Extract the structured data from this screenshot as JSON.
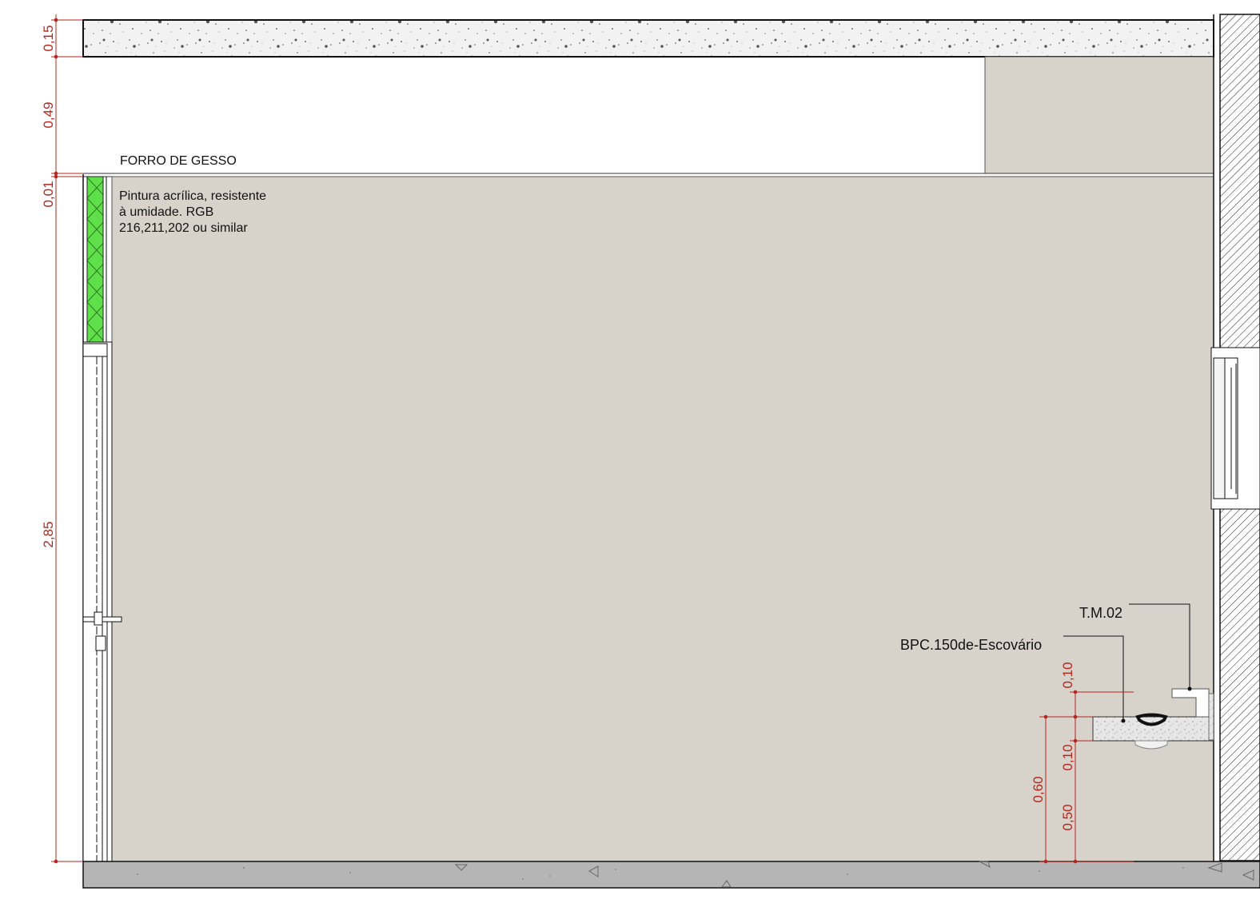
{
  "colors": {
    "wall_paint": "#d8d3ca",
    "dimension": "#b3261e",
    "insulation": "#5fe04a",
    "floor": "#b5b5b5",
    "line": "#111111"
  },
  "labels": {
    "ceiling": "FORRO DE GESSO",
    "paint_line1": "Pintura acrílica, resistente",
    "paint_line2": "à umidade. RGB",
    "paint_line3": "216,211,202 ou similar",
    "faucet_tag": "T.M.02",
    "sink_tag": "BPC.150de-Escovário"
  },
  "dimensions": {
    "slab": "0,15",
    "plenum": "0,49",
    "ceiling_gap": "0,01",
    "wall_height": "2,85",
    "faucet_height": "0,10",
    "counter_thickness": "0,10",
    "counter_total_height": "0,60",
    "counter_base_height": "0,50"
  },
  "icons": [
    "hatch-pattern",
    "concrete-pattern",
    "insulation-cross-pattern"
  ]
}
